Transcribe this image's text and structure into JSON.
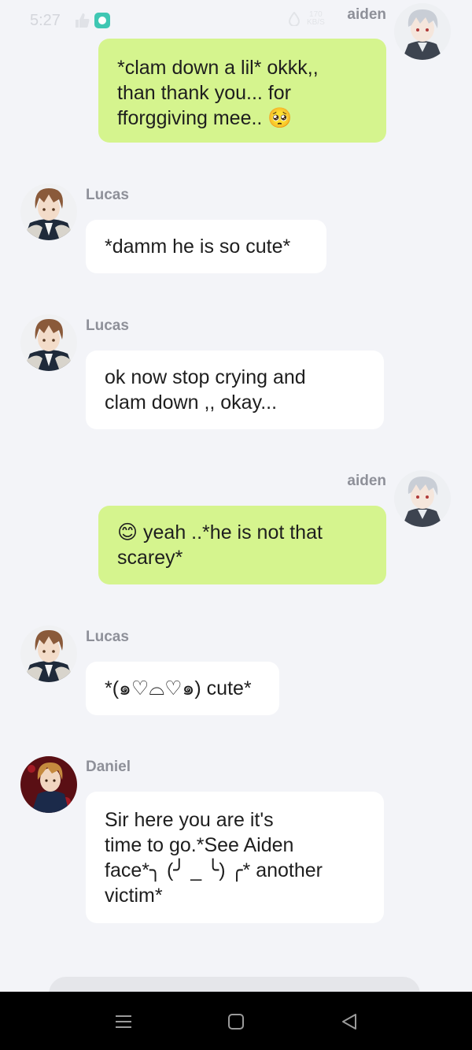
{
  "status_bar": {
    "time": "5:27",
    "speed_value": "170",
    "speed_unit": "KB/S"
  },
  "messages": [
    {
      "sender": "aiden",
      "direction": "outgoing",
      "avatar": "aiden-avatar",
      "lines": [
        "*clam down a lil* okkk,,",
        "than thank you... for",
        "fforggiving mee.. 🥺"
      ]
    },
    {
      "sender": "Lucas",
      "direction": "incoming",
      "avatar": "lucas-avatar",
      "lines": [
        "*damm he is so cute*"
      ]
    },
    {
      "sender": "Lucas",
      "direction": "incoming",
      "avatar": "lucas-avatar",
      "lines": [
        "ok now stop crying and",
        "clam down ,, okay..."
      ]
    },
    {
      "sender": "aiden",
      "direction": "outgoing",
      "avatar": "aiden-avatar",
      "lines": [
        "😊 yeah ..*he is not that",
        "scarey*"
      ]
    },
    {
      "sender": "Lucas",
      "direction": "incoming",
      "avatar": "lucas-avatar",
      "lines": [
        "*(๑♡⌓♡๑) cute*"
      ]
    },
    {
      "sender": "Daniel",
      "direction": "incoming",
      "avatar": "daniel-avatar",
      "lines": [
        "Sir here you are it's",
        "time to go.*See Aiden",
        "face*╮ (╯ _ ╰) ╭* another",
        "victim*"
      ]
    }
  ],
  "nav_bar": {
    "icons": [
      "menu-icon",
      "home-square-icon",
      "back-triangle-icon"
    ]
  },
  "colors": {
    "background": "#f3f4f8",
    "incoming_bubble": "#ffffff",
    "outgoing_bubble": "#d5f48e",
    "name_text": "#8e9099"
  }
}
